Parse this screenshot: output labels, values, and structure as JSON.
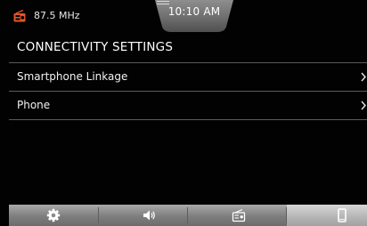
{
  "status_bar": {
    "frequency": "87.5 MHz",
    "clock": "10:10 AM",
    "radio_icon": "radio-icon",
    "radio_icon_color": "#e0552b"
  },
  "page": {
    "title": "CONNECTIVITY SETTINGS"
  },
  "menu": {
    "items": [
      {
        "label": "Smartphone Linkage",
        "icon": "chevron-right-icon"
      },
      {
        "label": "Phone",
        "icon": "chevron-right-icon"
      }
    ]
  },
  "bottom_nav": {
    "items": [
      {
        "icon": "gear-icon",
        "active": false
      },
      {
        "icon": "speaker-icon",
        "active": false
      },
      {
        "icon": "radio-icon",
        "active": false
      },
      {
        "icon": "smartphone-icon",
        "active": true
      }
    ]
  }
}
